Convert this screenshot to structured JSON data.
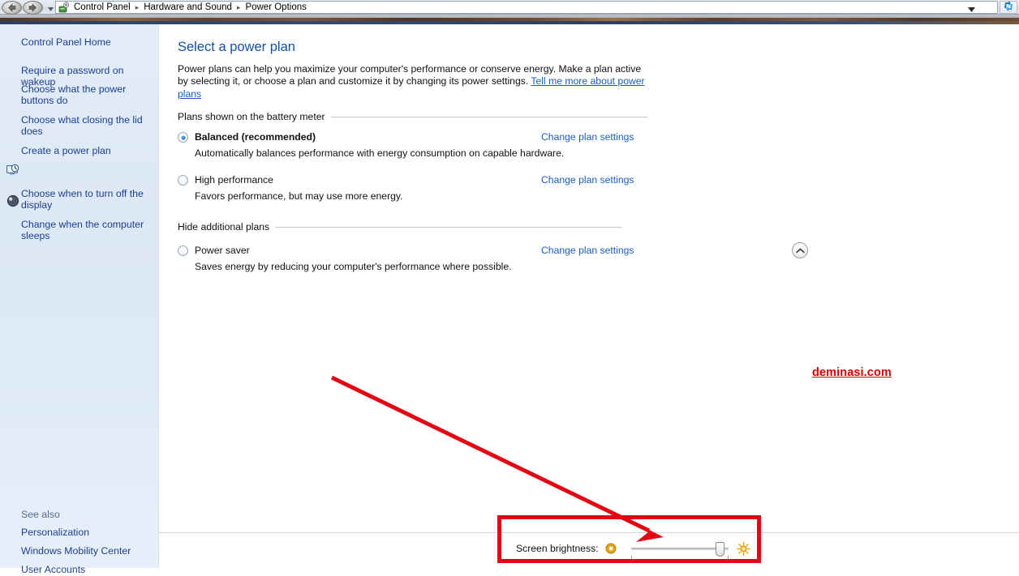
{
  "titlebar": {
    "back_icon": "back-arrow-icon",
    "forward_icon": "forward-arrow-icon",
    "nav_dropdown_icon": "chevron-down-icon",
    "app_icon": "control-panel-icon",
    "breadcrumbs": [
      "Control Panel",
      "Hardware and Sound",
      "Power Options"
    ],
    "separator": "▸",
    "address_chevron_icon": "chevron-down-icon",
    "refresh_icon": "refresh-icon"
  },
  "sidebar": {
    "home_label": "Control Panel Home",
    "items": [
      {
        "label": "Require a password on wakeup",
        "icon": null
      },
      {
        "label": "Choose what the power buttons do",
        "icon": null
      },
      {
        "label": "Choose what closing the lid does",
        "icon": null
      },
      {
        "label": "Create a power plan",
        "icon": null
      },
      {
        "label": "Choose when to turn off the display",
        "icon": "monitor-clock-icon"
      },
      {
        "label": "Change when the computer sleeps",
        "icon": "sleep-moon-icon"
      }
    ],
    "see_also_label": "See also",
    "see_also_items": [
      {
        "label": "Personalization"
      },
      {
        "label": "Windows Mobility Center"
      },
      {
        "label": "User Accounts"
      }
    ]
  },
  "main": {
    "title": "Select a power plan",
    "intro_text": "Power plans can help you maximize your computer's performance or conserve energy. Make a plan active by selecting it, or choose a plan and customize it by changing its power settings. ",
    "intro_link": "Tell me more about power plans",
    "group1_label": "Plans shown on the battery meter",
    "group2_label": "Hide additional plans",
    "collapse_icon": "chevron-up-icon",
    "change_link_label": "Change plan settings",
    "plans": [
      {
        "name": "Balanced (recommended)",
        "description": "Automatically balances performance with energy consumption on capable hardware.",
        "selected": true,
        "link": "Change plan settings"
      },
      {
        "name": "High performance",
        "description": "Favors performance, but may use more energy.",
        "selected": false,
        "link": "Change plan settings"
      },
      {
        "name": "Power saver",
        "description": "Saves energy by reducing your computer's performance where possible.",
        "selected": false,
        "link": "Change plan settings"
      }
    ]
  },
  "brightness": {
    "label": "Screen brightness:",
    "dim_icon": "dim-brightness-icon",
    "bright_icon": "sun-brightness-icon",
    "value_percent": 95
  },
  "annotations": {
    "watermark": "deminasi.com",
    "watermark_color": "#d30000",
    "highlight_color": "#e30613",
    "arrow_color": "#e30613"
  }
}
